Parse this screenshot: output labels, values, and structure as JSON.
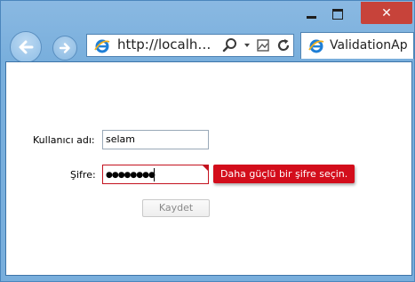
{
  "browser": {
    "address_url": "http://localh…",
    "tab_title": "ValidationAp",
    "close_symbol": "✕"
  },
  "form": {
    "username_label": "Kullanıcı adı:",
    "username_value": "selam",
    "password_label": "Şifre:",
    "password_mask": "●●●●●●●●",
    "password_error": "Daha güçlü bir şifre seçin.",
    "submit_label": "Kaydet"
  },
  "colors": {
    "error_red": "#d30d1b",
    "window_frame": "#78aedc",
    "close_button": "#c7433a"
  }
}
